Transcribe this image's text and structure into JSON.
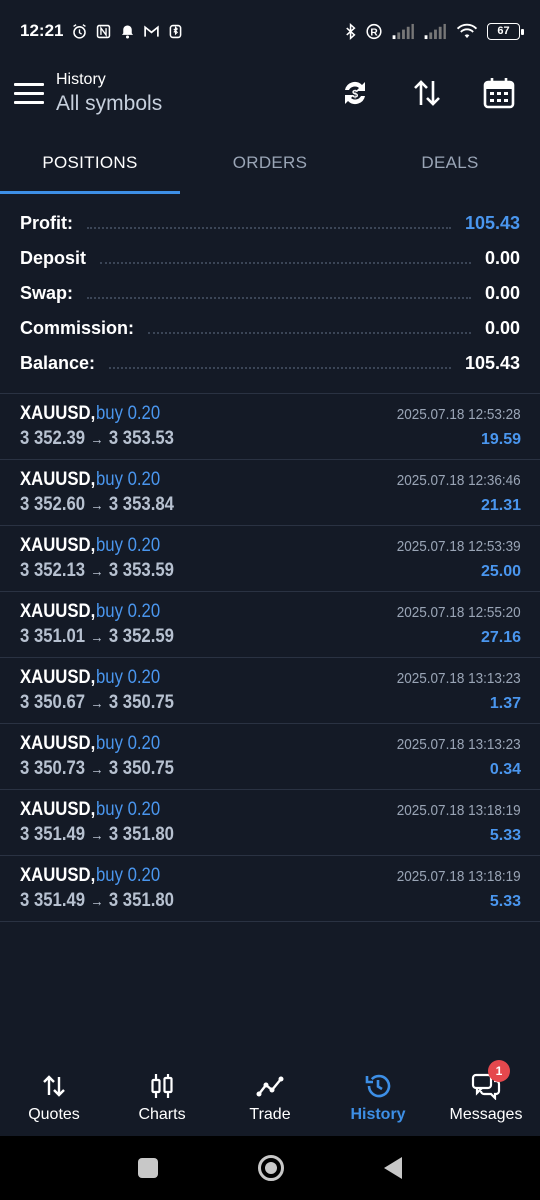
{
  "status_bar": {
    "time": "12:21",
    "battery": "67",
    "left_icons": [
      "alarm-icon",
      "nfc-icon",
      "bell-icon",
      "gmail-icon",
      "bluetooth-tag-icon"
    ],
    "right_icons": [
      "bluetooth-icon",
      "registered-icon",
      "signal-icon",
      "signal-icon",
      "wifi-icon"
    ]
  },
  "app_bar": {
    "title_small": "History",
    "title_big": "All symbols",
    "actions": [
      "currency-refresh-icon",
      "sort-icon",
      "calendar-icon"
    ]
  },
  "tabs": [
    {
      "label": "POSITIONS",
      "active": true
    },
    {
      "label": "ORDERS",
      "active": false
    },
    {
      "label": "DEALS",
      "active": false
    }
  ],
  "summary": [
    {
      "label": "Profit:",
      "value": "105.43",
      "highlight": true
    },
    {
      "label": "Deposit",
      "value": "0.00",
      "highlight": false
    },
    {
      "label": "Swap:",
      "value": "0.00",
      "highlight": false
    },
    {
      "label": "Commission:",
      "value": "0.00",
      "highlight": false
    },
    {
      "label": "Balance:",
      "value": "105.43",
      "highlight": false
    }
  ],
  "trades": [
    {
      "symbol": "XAUUSD,",
      "side": "buy 0.20",
      "open": "3 352.39",
      "close": "3 353.53",
      "time": "2025.07.18 12:53:28",
      "profit": "19.59"
    },
    {
      "symbol": "XAUUSD,",
      "side": "buy 0.20",
      "open": "3 352.60",
      "close": "3 353.84",
      "time": "2025.07.18 12:36:46",
      "profit": "21.31"
    },
    {
      "symbol": "XAUUSD,",
      "side": "buy 0.20",
      "open": "3 352.13",
      "close": "3 353.59",
      "time": "2025.07.18 12:53:39",
      "profit": "25.00"
    },
    {
      "symbol": "XAUUSD,",
      "side": "buy 0.20",
      "open": "3 351.01",
      "close": "3 352.59",
      "time": "2025.07.18 12:55:20",
      "profit": "27.16"
    },
    {
      "symbol": "XAUUSD,",
      "side": "buy 0.20",
      "open": "3 350.67",
      "close": "3 350.75",
      "time": "2025.07.18 13:13:23",
      "profit": "1.37"
    },
    {
      "symbol": "XAUUSD,",
      "side": "buy 0.20",
      "open": "3 350.73",
      "close": "3 350.75",
      "time": "2025.07.18 13:13:23",
      "profit": "0.34"
    },
    {
      "symbol": "XAUUSD,",
      "side": "buy 0.20",
      "open": "3 351.49",
      "close": "3 351.80",
      "time": "2025.07.18 13:18:19",
      "profit": "5.33"
    },
    {
      "symbol": "XAUUSD,",
      "side": "buy 0.20",
      "open": "3 351.49",
      "close": "3 351.80",
      "time": "2025.07.18 13:18:19",
      "profit": "5.33"
    }
  ],
  "bottom_nav": [
    {
      "label": "Quotes",
      "icon": "quotes-icon",
      "active": false
    },
    {
      "label": "Charts",
      "icon": "charts-icon",
      "active": false
    },
    {
      "label": "Trade",
      "icon": "trade-icon",
      "active": false
    },
    {
      "label": "History",
      "icon": "history-icon",
      "active": true
    },
    {
      "label": "Messages",
      "icon": "messages-icon",
      "active": false,
      "badge": "1"
    }
  ],
  "colors": {
    "background": "#141a26",
    "accent": "#3d8fe6",
    "profit_blue": "#4a96ee",
    "muted": "#9aa5b6",
    "badge_red": "#e5484d"
  }
}
